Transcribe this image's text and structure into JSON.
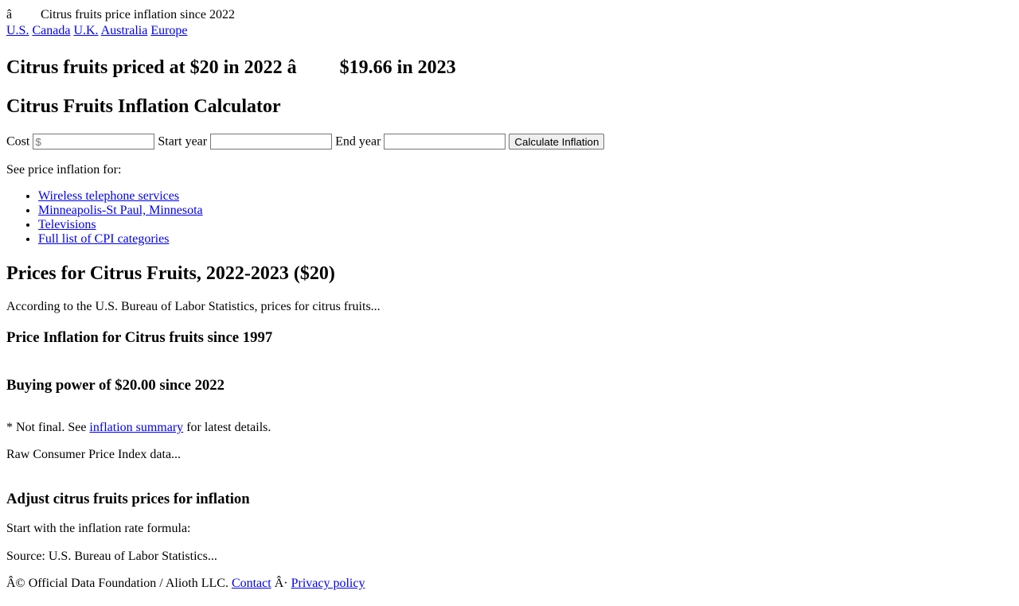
{
  "top_banner": {
    "prefix": "â",
    "text": "Citrus fruits price inflation since 2022"
  },
  "country_nav": [
    {
      "label": "U.S."
    },
    {
      "label": "Canada"
    },
    {
      "label": "U.K."
    },
    {
      "label": "Australia"
    },
    {
      "label": "Europe"
    }
  ],
  "headline": {
    "left": "Citrus fruits priced at $20 in 2022 â",
    "right": "$19.66 in 2023"
  },
  "calculator": {
    "title": "Citrus Fruits Inflation Calculator",
    "cost_label": "Cost",
    "cost_placeholder": "$",
    "start_label": "Start year",
    "end_label": "End year",
    "button_label": "Calculate Inflation"
  },
  "see_also": {
    "intro": "See price inflation for:",
    "links": [
      {
        "label": "Wireless telephone services"
      },
      {
        "label": "Minneapolis-St Paul, Minnesota"
      },
      {
        "label": "Televisions"
      },
      {
        "label": "Full list of CPI categories"
      }
    ]
  },
  "prices_section": {
    "title": "Prices for Citrus Fruits, 2022-2023 ($20)",
    "body": "According to the U.S. Bureau of Labor Statistics, prices for citrus fruits..."
  },
  "inflation_since": {
    "title": "Price Inflation for Citrus fruits since 1997"
  },
  "buying_power": {
    "title": "Buying power of $20.00 since 2022"
  },
  "not_final": {
    "prefix": "* Not final. See",
    "link": "inflation summary",
    "suffix": "for latest details."
  },
  "raw_cpi": {
    "text": "Raw Consumer Price Index data..."
  },
  "adjust": {
    "title": "Adjust citrus fruits prices for inflation",
    "formula_intro": "Start with the inflation rate formula:",
    "source": "Source: U.S. Bureau of Labor Statistics..."
  },
  "footer": {
    "copyright": "Â© Official Data Foundation / Alioth LLC.",
    "contact": "Contact",
    "separator": "Â·",
    "privacy": "Privacy policy"
  }
}
